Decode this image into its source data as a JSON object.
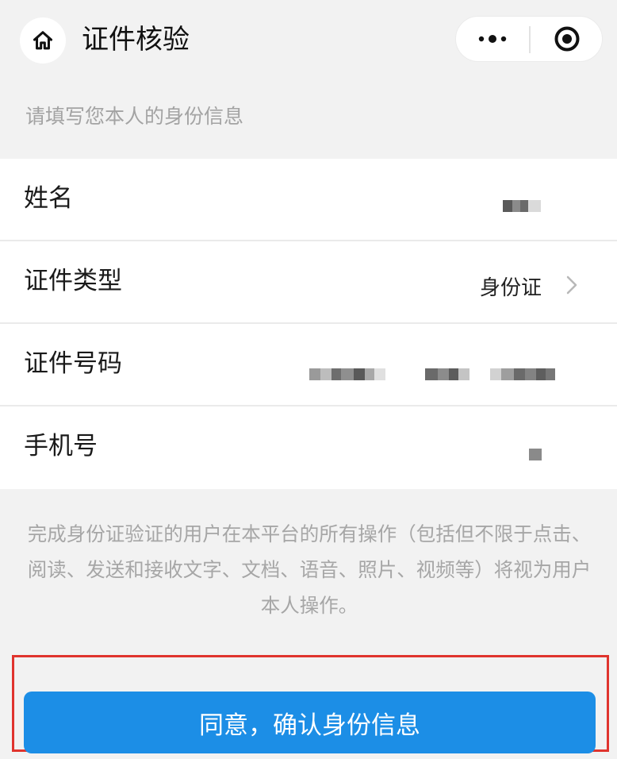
{
  "header": {
    "title": "证件核验",
    "home_icon": "home-icon",
    "more_icon": "more-dots-icon",
    "close_icon": "target-circle-icon"
  },
  "hint": "请填写您本人的身份信息",
  "form": {
    "rows": [
      {
        "label": "姓名",
        "value": ""
      },
      {
        "label": "证件类型",
        "value": "身份证"
      },
      {
        "label": "证件号码",
        "value": ""
      },
      {
        "label": "手机号",
        "value": ""
      }
    ]
  },
  "notice": "完成身份证验证的用户在本平台的所有操作（包括但不限于点击、阅读、发送和接收文字、文档、语音、照片、视频等）将视为用户本人操作。",
  "confirm_button": {
    "label": "同意，确认身份信息"
  },
  "colors": {
    "accent": "#1c8ee6",
    "highlight": "#e0342e",
    "background": "#f2f2f2",
    "hint_text": "#a3a3a3"
  }
}
